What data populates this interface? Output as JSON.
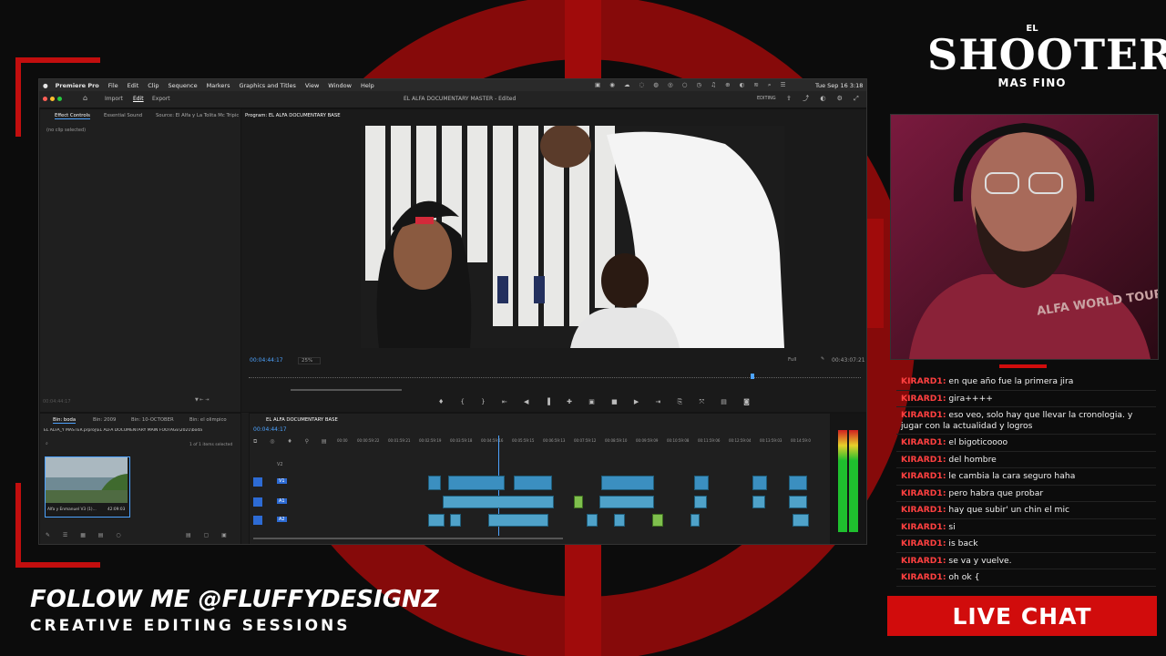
{
  "overlay": {
    "logo_top": "EL",
    "logo_main": "SHOOTER",
    "logo_bottom": "MAS FINO",
    "follow_text": "FOLLOW ME @FLUFFYDESIGNZ",
    "sessions_text": "CREATIVE EDITING SESSIONS",
    "live_chat_label": "LIVE CHAT",
    "accent_color": "#d10c0c",
    "hoodie_text": "ALFA WORLD TOUR"
  },
  "menubar": {
    "app_name": "Premiere Pro",
    "items": [
      "File",
      "Edit",
      "Clip",
      "Sequence",
      "Markers",
      "Graphics and Titles",
      "View",
      "Window",
      "Help"
    ],
    "clock": "Tue Sep 16 3:18"
  },
  "titlebar": {
    "nav": [
      "Import",
      "Edit",
      "Export"
    ],
    "document_title": "EL ALFA DOCUMENTARY MASTER - Edited",
    "workspace": "EDITING"
  },
  "source_panel": {
    "tabs": [
      "Effect Controls",
      "Essential Sound",
      "Source: El Alfa y La Tolita Mc Tripic",
      "Program: EL ALFA DOCUMENTARY BASE"
    ],
    "no_clip": "(no clip selected)",
    "timecode": "00:04:44:17"
  },
  "program": {
    "timecode": "00:04:44:17",
    "zoom": "25%",
    "quality": "Full",
    "duration": "00:43:07:21"
  },
  "project_panel": {
    "tabs": [
      "Bin: boda",
      "Bin: 2009",
      "Bin: 10-OCTOBER",
      "Bin: el olimpico"
    ],
    "path": "EL ALFA_Y MASTER.prproj\\EL ALFA DOCUMENTARY MAIN FOOTAGE\\2021\\boda",
    "items_count": "1 of 1 items selected",
    "thumb_label": "Alfa y Enmanuel V3 (1)...",
    "thumb_duration": "42:09:03"
  },
  "timeline": {
    "tab": "EL ALFA DOCUMENTARY BASE",
    "timecode": "00:04:44:17",
    "ruler": [
      "00:00",
      "00:00:59:22",
      "00:01:59:21",
      "00:02:59:19",
      "00:03:59:18",
      "00:04:59:16",
      "00:05:59:15",
      "00:06:59:13",
      "00:07:59:12",
      "00:08:59:10",
      "00:09:59:09",
      "00:10:59:08",
      "00:11:59:06",
      "00:12:59:04",
      "00:13:59:03",
      "00:14:59:0"
    ],
    "tracks": [
      "V2",
      "V1",
      "A1",
      "A2"
    ]
  },
  "chat": {
    "messages": [
      {
        "user": "KIRARD1:",
        "text": "en que año fue la primera jira"
      },
      {
        "user": "KIRARD1:",
        "text": "gira++++"
      },
      {
        "user": "KIRARD1:",
        "text": "eso veo, solo hay que llevar la cronologia. y jugar con la actualidad y logros"
      },
      {
        "user": "KIRARD1:",
        "text": "el bigoticoooo"
      },
      {
        "user": "KIRARD1:",
        "text": "del hombre"
      },
      {
        "user": "KIRARD1:",
        "text": "le cambia la cara seguro haha"
      },
      {
        "user": "KIRARD1:",
        "text": "pero habra que probar"
      },
      {
        "user": "KIRARD1:",
        "text": "hay que subir' un chin el mic"
      },
      {
        "user": "KIRARD1:",
        "text": "si"
      },
      {
        "user": "KIRARD1:",
        "text": "is back"
      },
      {
        "user": "KIRARD1:",
        "text": "se va y vuelve."
      },
      {
        "user": "KIRARD1:",
        "text": "oh ok {"
      }
    ]
  }
}
